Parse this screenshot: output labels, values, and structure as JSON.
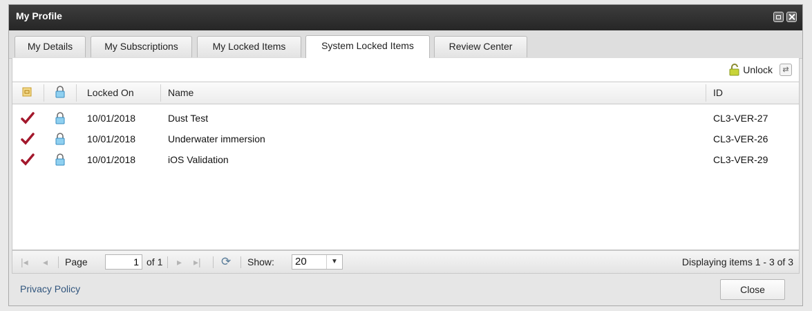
{
  "window": {
    "title": "My Profile"
  },
  "tabs": [
    {
      "label": "My Details"
    },
    {
      "label": "My Subscriptions"
    },
    {
      "label": "My Locked Items"
    },
    {
      "label": "System Locked Items",
      "active": true
    },
    {
      "label": "Review Center"
    }
  ],
  "toolbar": {
    "unlock_label": "Unlock",
    "refresh_icon": "refresh-icon"
  },
  "grid": {
    "columns": [
      "Locked On",
      "Name",
      "ID"
    ],
    "rows": [
      {
        "locked_on": "10/01/2018",
        "name": "Dust Test",
        "id": "CL3-VER-27"
      },
      {
        "locked_on": "10/01/2018",
        "name": "Underwater immersion",
        "id": "CL3-VER-26"
      },
      {
        "locked_on": "10/01/2018",
        "name": "iOS Validation",
        "id": "CL3-VER-29"
      }
    ]
  },
  "pager": {
    "page_label": "Page",
    "page_value": "1",
    "of_label": "of 1",
    "show_label": "Show:",
    "show_value": "20",
    "summary": "Displaying items 1 - 3 of 3"
  },
  "footer": {
    "privacy_link": "Privacy Policy",
    "close_label": "Close"
  },
  "colors": {
    "titlebar": "#2f2f2f",
    "check": "#a3182c",
    "lock": "#5fb0e0",
    "link": "#31557d"
  }
}
